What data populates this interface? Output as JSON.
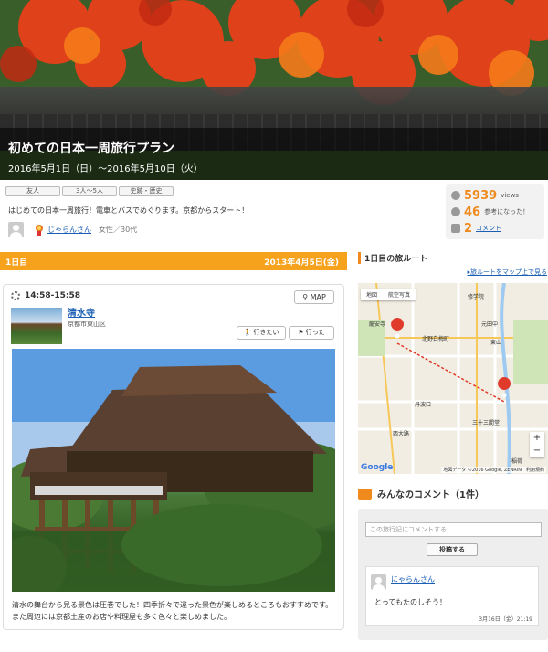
{
  "header": {
    "title": "初めての日本一周旅行プラン",
    "dates": "2016年5月1日（日）～2016年5月10日（火）"
  },
  "tags": [
    "友人",
    "3人～5人",
    "史跡・歴史"
  ],
  "description": "はじめての日本一周旅行！電車とバスでめぐります。京都からスタート！",
  "author": {
    "name": "じゃらんさん",
    "meta": "女性／30代"
  },
  "stats": {
    "views": "5939",
    "views_label": "views",
    "helpful": "46",
    "helpful_label": "参考になった！",
    "comments": "2",
    "comments_label": "コメント"
  },
  "day": {
    "label": "1日目",
    "date": "2013年4月5日(金)"
  },
  "spot": {
    "time": "14:58-15:58",
    "map_label": "MAP",
    "name": "清水寺",
    "location": "京都市東山区",
    "want_label": "行きたい",
    "went_label": "行った",
    "caption": "清水の舞台から見る景色は圧巻でした！四季折々で違った景色が楽しめるところもおすすめです。また周辺には京都土産のお店や料理屋も多く色々と楽しめました。"
  },
  "route": {
    "title": "1日目の旅ルート",
    "link": "旅ルートをマップ上で見る",
    "map_tabs": [
      "地図",
      "航空写真"
    ],
    "attribution": "地図データ ©2016 Google, ZENRIN　利用規約",
    "google": "Google",
    "labels": [
      "修学院",
      "龍安寺",
      "北野白梅町",
      "元田中",
      "東山",
      "西大路",
      "丹波口",
      "三十三間堂",
      "稲荷"
    ]
  },
  "comments": {
    "title": "みんなのコメント（1件）",
    "placeholder": "この旅行記にコメントする",
    "post_label": "投稿する",
    "items": [
      {
        "user": "にゃらんさん",
        "text": "とってもたのしそう！",
        "date": "3月16日（金）21:19"
      }
    ]
  },
  "colors": {
    "accent": "#f6a21c",
    "link": "#1a5fb4",
    "number": "#f08a1c"
  }
}
